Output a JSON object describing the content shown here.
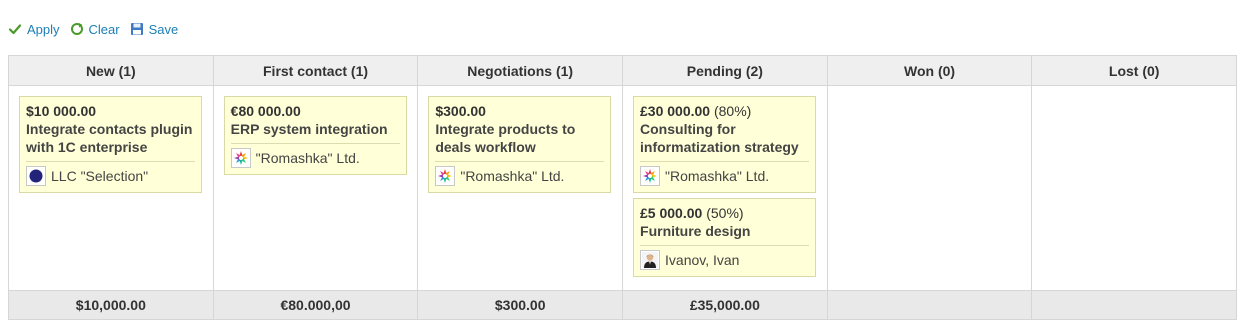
{
  "toolbar": {
    "apply_label": "Apply",
    "clear_label": "Clear",
    "save_label": "Save"
  },
  "columns": [
    {
      "header": "New (1)",
      "total": "$10,000.00",
      "cards": [
        {
          "amount": "$10 000.00",
          "percent": "",
          "title": "Integrate contacts plugin with 1C enterprise",
          "client": "LLC \"Selection\"",
          "avatar": "dark-circle-avatar"
        }
      ]
    },
    {
      "header": "First contact (1)",
      "total": "€80.000,00",
      "cards": [
        {
          "amount": "€80 000.00",
          "percent": "",
          "title": "ERP system integration",
          "client": "\"Romashka\" Ltd.",
          "avatar": "flower-logo-avatar"
        }
      ]
    },
    {
      "header": "Negotiations (1)",
      "total": "$300.00",
      "cards": [
        {
          "amount": "$300.00",
          "percent": "",
          "title": "Integrate products to deals workflow",
          "client": "\"Romashka\" Ltd.",
          "avatar": "flower-logo-avatar"
        }
      ]
    },
    {
      "header": "Pending (2)",
      "total": "£35,000.00",
      "cards": [
        {
          "amount": "£30 000.00",
          "percent": "(80%)",
          "title": "Consulting for informatization strategy",
          "client": "\"Romashka\" Ltd.",
          "avatar": "flower-logo-avatar"
        },
        {
          "amount": "£5 000.00",
          "percent": "(50%)",
          "title": "Furniture design",
          "client": "Ivanov, Ivan",
          "avatar": "person-photo-avatar"
        }
      ]
    },
    {
      "header": "Won (0)",
      "total": "",
      "cards": []
    },
    {
      "header": "Lost (0)",
      "total": "",
      "cards": []
    }
  ],
  "colors": {
    "link": "#1c7fb4",
    "card_bg": "#ffffd8",
    "header_bg": "#efefef",
    "border": "#d6d6d6"
  }
}
